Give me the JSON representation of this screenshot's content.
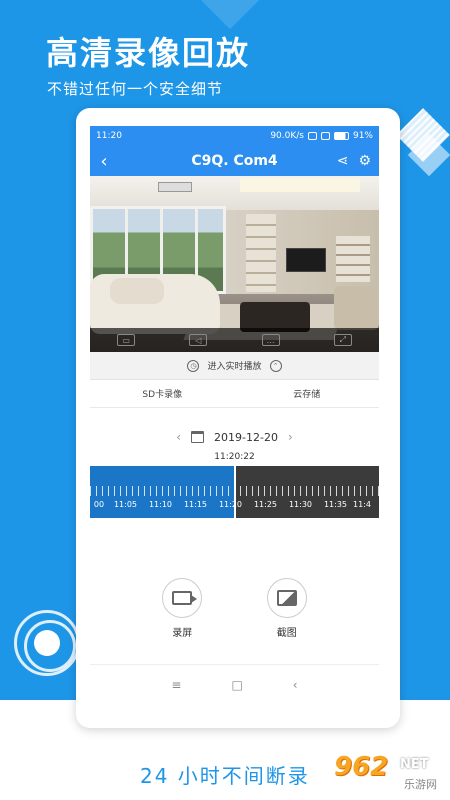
{
  "promo": {
    "headline": "高清录像回放",
    "subline": "不错过任何一个安全细节",
    "bottom_caption": "24 小时不间断录",
    "watermark_logo": "962",
    "watermark_net": "NET",
    "watermark_site": "乐游网"
  },
  "status_bar": {
    "time": "11:20",
    "speed": "90.0K/s",
    "battery": "91%"
  },
  "app_bar": {
    "back_icon": "‹",
    "title": "C9Q. Com4",
    "share_icon": "share-icon",
    "settings_icon": "gear-icon"
  },
  "video_controls": [
    "quality",
    "mute",
    "message",
    "fullscreen"
  ],
  "live_row": {
    "label": "进入实时播放"
  },
  "tabs": [
    "SD卡录像",
    "云存储"
  ],
  "date_picker": {
    "date": "2019-12-20",
    "prev": "‹",
    "next": "›"
  },
  "timeline": {
    "current_time": "11:20:22",
    "labels": [
      "00",
      "11:05",
      "11:10",
      "11:15",
      "11:20",
      "11:25",
      "11:30",
      "11:35",
      "11:4"
    ]
  },
  "actions": {
    "record_label": "录屏",
    "screenshot_label": "截图"
  },
  "nav": {
    "menu": "≡",
    "home": "□",
    "back": "‹"
  },
  "colors": {
    "brand_blue": "#1e96e8",
    "app_blue": "#2b8ef0",
    "timeline_blue": "#1c76c8"
  }
}
